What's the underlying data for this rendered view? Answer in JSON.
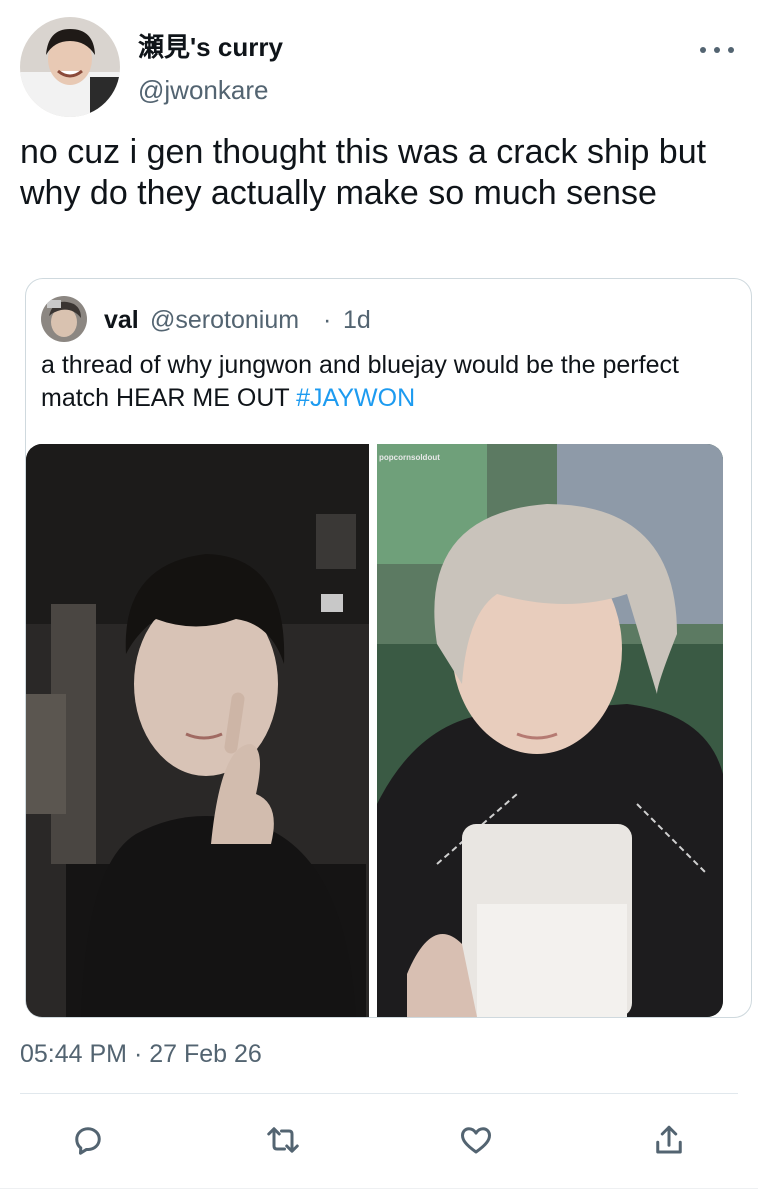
{
  "tweet": {
    "author": {
      "display_name": "瀬見's curry",
      "handle": "@jwonkare"
    },
    "text": "no cuz i gen thought this was a crack ship but why do they actually make so much sense",
    "timestamp": "05:44 PM · 27 Feb 26"
  },
  "quoted_tweet": {
    "author": {
      "display_name": "val",
      "handle": "@serotonium"
    },
    "separator": "·",
    "age": "1d",
    "text": "a thread of why jungwon and bluejay would be the perfect match HEAR ME OUT ",
    "hashtag": "#JAYWON",
    "right_photo_watermark": "popcornsoldout"
  },
  "actions": [
    {
      "name": "reply",
      "icon": "reply-icon"
    },
    {
      "name": "retweet",
      "icon": "retweet-icon"
    },
    {
      "name": "like",
      "icon": "heart-icon"
    },
    {
      "name": "share",
      "icon": "share-icon"
    }
  ],
  "colors": {
    "text_primary": "#0f1419",
    "text_secondary": "#536471",
    "hashtag": "#1d9bf0",
    "border": "#cfd9de"
  }
}
